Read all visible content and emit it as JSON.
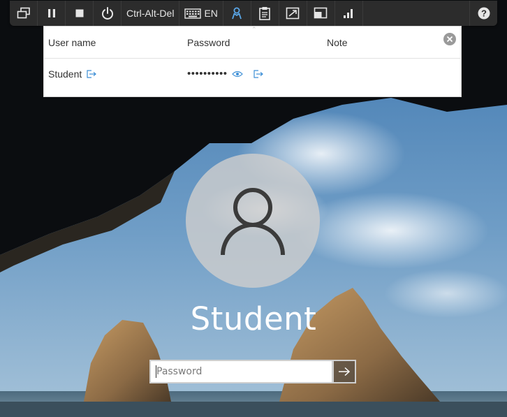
{
  "toolbar": {
    "ctrl_alt_del": "Ctrl-Alt-Del",
    "keyboard_lang": "EN",
    "active_color": "#5aa7e8",
    "icons": [
      "windows-icon",
      "pause-icon",
      "stop-icon",
      "power-icon",
      "keyboard-icon",
      "credentials-icon",
      "clipboard-icon",
      "fullscreen-icon",
      "display-icon",
      "signal-bars-icon",
      "help-icon"
    ],
    "help_label": "?"
  },
  "credentials": {
    "headers": {
      "username": "User name",
      "password": "Password",
      "note": "Note"
    },
    "rows": [
      {
        "username": "Student",
        "password": "••••••••••",
        "note": ""
      }
    ],
    "link_color": "#3d8fd6"
  },
  "login": {
    "user": "Student",
    "password_placeholder": "Password"
  }
}
